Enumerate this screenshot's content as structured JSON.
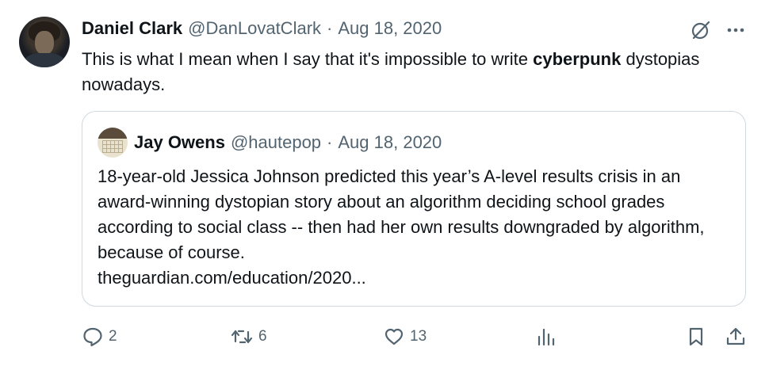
{
  "tweet": {
    "author_name": "Daniel Clark",
    "author_handle": "@DanLovatClark",
    "separator": "·",
    "date": "Aug 18, 2020",
    "text_before": "This is what I mean when I say that it's impossible to write ",
    "text_bold": "cyberpunk",
    "text_after": " dystopias nowadays."
  },
  "quoted_tweet": {
    "author_name": "Jay Owens",
    "author_handle": "@hautepop",
    "separator": "·",
    "date": "Aug 18, 2020",
    "text": "18-year-old Jessica Johnson predicted this year’s A-level results crisis in an award-winning dystopian story about an algorithm deciding school grades according to social class -- then had her own results downgraded by algorithm, because of course.",
    "link": "theguardian.com/education/2020..."
  },
  "actions": {
    "replies": "2",
    "retweets": "6",
    "likes": "13"
  },
  "icons": {
    "top_right": [
      "grok-icon",
      "more-icon"
    ],
    "action_bar": [
      "reply-icon",
      "retweet-icon",
      "like-icon",
      "views-icon",
      "bookmark-icon",
      "share-icon"
    ]
  },
  "colors": {
    "text": "#0f1419",
    "secondary": "#536471",
    "border": "#cfd9de"
  }
}
